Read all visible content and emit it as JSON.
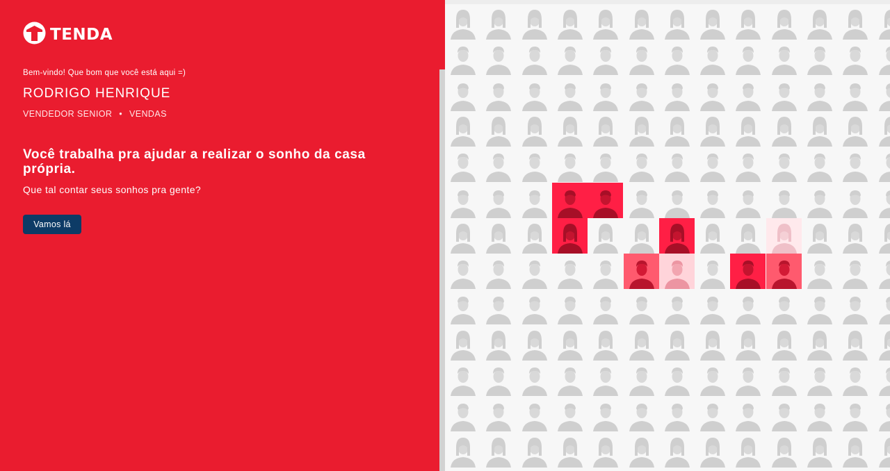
{
  "brand": {
    "name": "TENDA",
    "logo_icon": "tenda-house-logo-icon"
  },
  "welcome_text": "Bem-vindo! Que bom que você está aqui =)",
  "user": {
    "name": "RODRIGO HENRIQUE",
    "role": "VENDEDOR SENIOR",
    "separator": "•",
    "department": "VENDAS"
  },
  "headline": "Você trabalha pra ajudar a realizar o sonho da casa própria.",
  "subheadline": "Que tal contar seus sonhos pra gente?",
  "cta_label": "Vamos lá",
  "colors": {
    "brand_red": "#ea1c2f",
    "button_navy": "#0d3b66",
    "highlight": "#ff1f45"
  },
  "mosaic": {
    "columns": 13,
    "rows": 13,
    "highlighted": [
      {
        "row": 5,
        "col": 3,
        "level": "strong"
      },
      {
        "row": 5,
        "col": 4,
        "level": "strong"
      },
      {
        "row": 6,
        "col": 3,
        "level": "strong"
      },
      {
        "row": 6,
        "col": 6,
        "level": "strong"
      },
      {
        "row": 7,
        "col": 5,
        "level": "medium"
      },
      {
        "row": 7,
        "col": 6,
        "level": "light"
      },
      {
        "row": 7,
        "col": 8,
        "level": "strong"
      },
      {
        "row": 7,
        "col": 9,
        "level": "medium"
      },
      {
        "row": 6,
        "col": 9,
        "level": "faint"
      }
    ]
  }
}
